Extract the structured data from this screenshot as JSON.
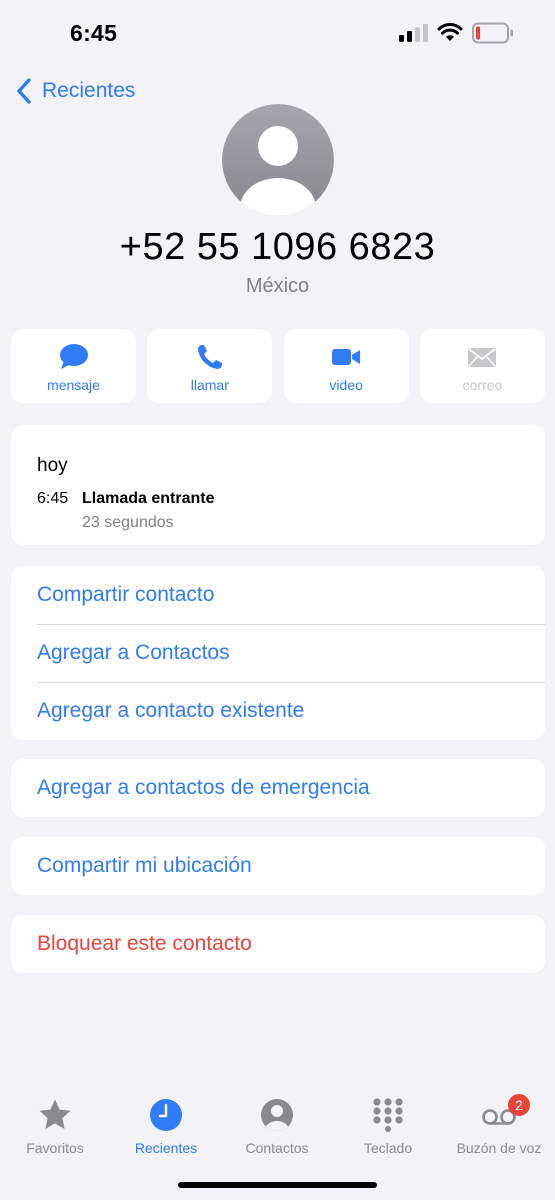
{
  "status_bar": {
    "time": "6:45"
  },
  "nav": {
    "back_label": "Recientes"
  },
  "contact": {
    "number": "+52 55 1096 6823",
    "country": "México"
  },
  "actions": [
    {
      "label": "mensaje",
      "icon": "message-icon",
      "enabled": true
    },
    {
      "label": "llamar",
      "icon": "phone-icon",
      "enabled": true
    },
    {
      "label": "video",
      "icon": "video-icon",
      "enabled": true
    },
    {
      "label": "correo",
      "icon": "mail-icon",
      "enabled": false
    }
  ],
  "recent": {
    "day": "hoy",
    "time": "6:45",
    "type": "Llamada entrante",
    "duration": "23 segundos"
  },
  "options": {
    "share_contact": "Compartir contacto",
    "add_to_contacts": "Agregar a Contactos",
    "add_to_existing": "Agregar a contacto existente",
    "add_emergency": "Agregar a contactos de emergencia",
    "share_location": "Compartir mi ubicación",
    "block_contact": "Bloquear este contacto"
  },
  "tabs": [
    {
      "label": "Favoritos",
      "icon": "star-icon",
      "active": false
    },
    {
      "label": "Recientes",
      "icon": "clock-icon",
      "active": true
    },
    {
      "label": "Contactos",
      "icon": "person-icon",
      "active": false
    },
    {
      "label": "Teclado",
      "icon": "keypad-icon",
      "active": false
    },
    {
      "label": "Buzón de voz",
      "icon": "voicemail-icon",
      "active": false,
      "badge": "2"
    }
  ],
  "colors": {
    "accent": "#2f7cf6",
    "danger": "#e8443a",
    "background": "#f2f2f7",
    "secondary_text": "#808085"
  }
}
